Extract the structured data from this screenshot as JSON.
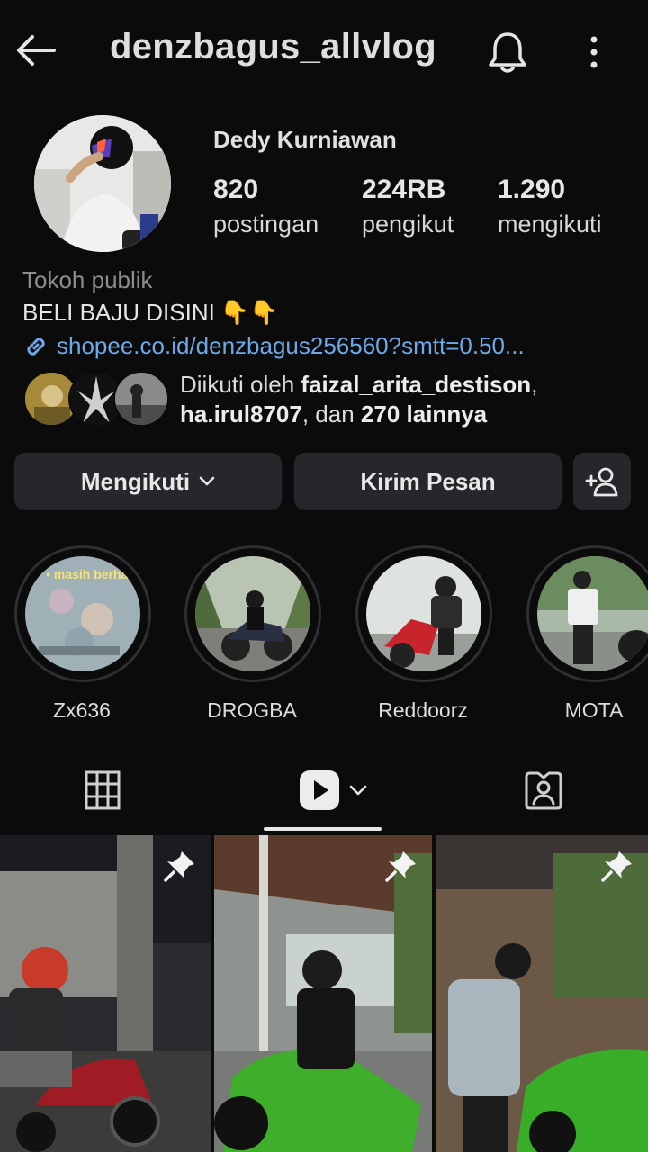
{
  "header": {
    "username": "denzbagus_allvlog",
    "back_icon": "arrow-left-icon",
    "bell_icon": "bell-icon",
    "more_icon": "more-vertical-icon"
  },
  "profile": {
    "full_name": "Dedy Kurniawan",
    "stats": [
      {
        "value": "820",
        "label": "postingan"
      },
      {
        "value": "224RB",
        "label": "pengikut"
      },
      {
        "value": "1.290",
        "label": "mengikuti"
      }
    ],
    "category": "Tokoh publik",
    "bio": "BELI BAJU DISINI",
    "bio_emoji": "👇👇",
    "link": "shopee.co.id/denzbagus256560?smtt=0.50...",
    "followed_by_prefix": "Diikuti oleh ",
    "followed_by_1": "faizal_arita_destison",
    "followed_by_sep": ", ",
    "followed_by_2": "ha.irul8707",
    "followed_by_mid": ", dan ",
    "followed_by_more": "270 lainnya"
  },
  "actions": {
    "following_label": "Mengikuti",
    "message_label": "Kirim Pesan"
  },
  "highlights": [
    {
      "label": "Zx636",
      "overlay_text": "• masih berharap •"
    },
    {
      "label": "DROGBA"
    },
    {
      "label": "Reddoorz"
    },
    {
      "label": "MOTA"
    }
  ],
  "tabs": {
    "active": "reels",
    "items": [
      "grid-icon",
      "reels-icon",
      "tagged-icon"
    ]
  },
  "colors": {
    "background": "#0b0b0c",
    "button_bg": "#26272b",
    "link": "#6ea8e8",
    "muted": "#8d8d8d"
  }
}
